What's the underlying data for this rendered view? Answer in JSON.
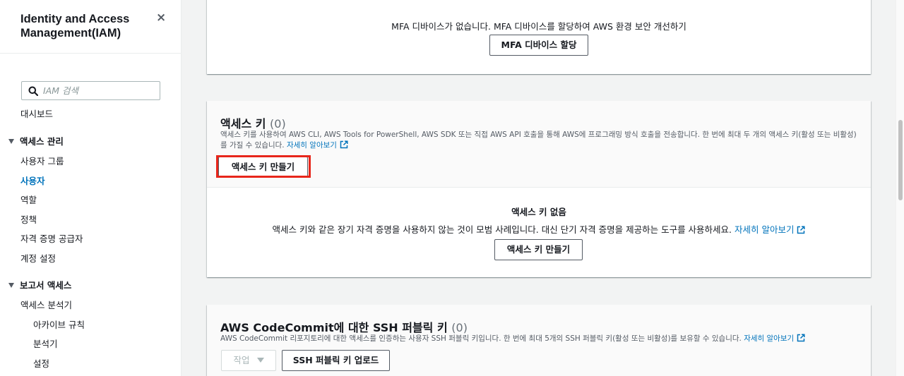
{
  "sidebar": {
    "title": "Identity and Access Management(IAM)",
    "close_icon": "×",
    "search": {
      "placeholder": "IAM 검색",
      "value": ""
    },
    "dashboard": "대시보드",
    "access_management": {
      "label": "액세스 관리",
      "items": [
        "사용자 그룹",
        "사용자",
        "역할",
        "정책",
        "자격 증명 공급자",
        "계정 설정"
      ],
      "active_index": 1
    },
    "reports": {
      "label": "보고서 액세스",
      "items": [
        "액세스 분석기"
      ],
      "subitems": [
        "아카이브 규칙",
        "분석기",
        "설정"
      ]
    }
  },
  "mfa": {
    "message": "MFA 디바이스가 없습니다. MFA 디바이스를 할당하여 AWS 환경 보안 개선하기",
    "assign_button": "MFA 디바이스 할당"
  },
  "access_keys": {
    "title": "액세스 키",
    "count": "(0)",
    "description": "액세스 키를 사용하여 AWS CLI, AWS Tools for PowerShell, AWS SDK 또는 직접 AWS API 호출을 통해 AWS에 프로그래밍 방식 호출을 전송합니다. 한 번에 최대 두 개의 액세스 키(활성 또는 비활성)를 가질 수 있습니다.",
    "learn_more": "자세히 알아보기",
    "create_button": "액세스 키 만들기",
    "empty_title": "액세스 키 없음",
    "empty_message": "액세스 키와 같은 장기 자격 증명을 사용하지 않는 것이 모범 사례입니다. 대신 단기 자격 증명을 제공하는 도구를 사용하세요.",
    "empty_learn_more": "자세히 알아보기",
    "empty_create_button": "액세스 키 만들기"
  },
  "ssh": {
    "title": "AWS CodeCommit에 대한 SSH 퍼블릭 키",
    "count": "(0)",
    "description": "AWS CodeCommit 리포지토리에 대한 액세스를 인증하는 사용자 SSH 퍼블릭 키입니다. 한 번에 최대 5개의 SSH 퍼블릭 키(활성 또는 비활성)를 보유할 수 있습니다.",
    "learn_more": "자세히 알아보기",
    "actions_button": "작업",
    "upload_button": "SSH 퍼블릭 키 업로드"
  },
  "colors": {
    "link": "#0073bb",
    "highlight": "#e8261b",
    "active_nav": "#0073bb"
  },
  "icons": [
    "close-icon",
    "search-icon",
    "caret-down-icon",
    "external-link-icon",
    "dropdown-arrow-icon"
  ]
}
